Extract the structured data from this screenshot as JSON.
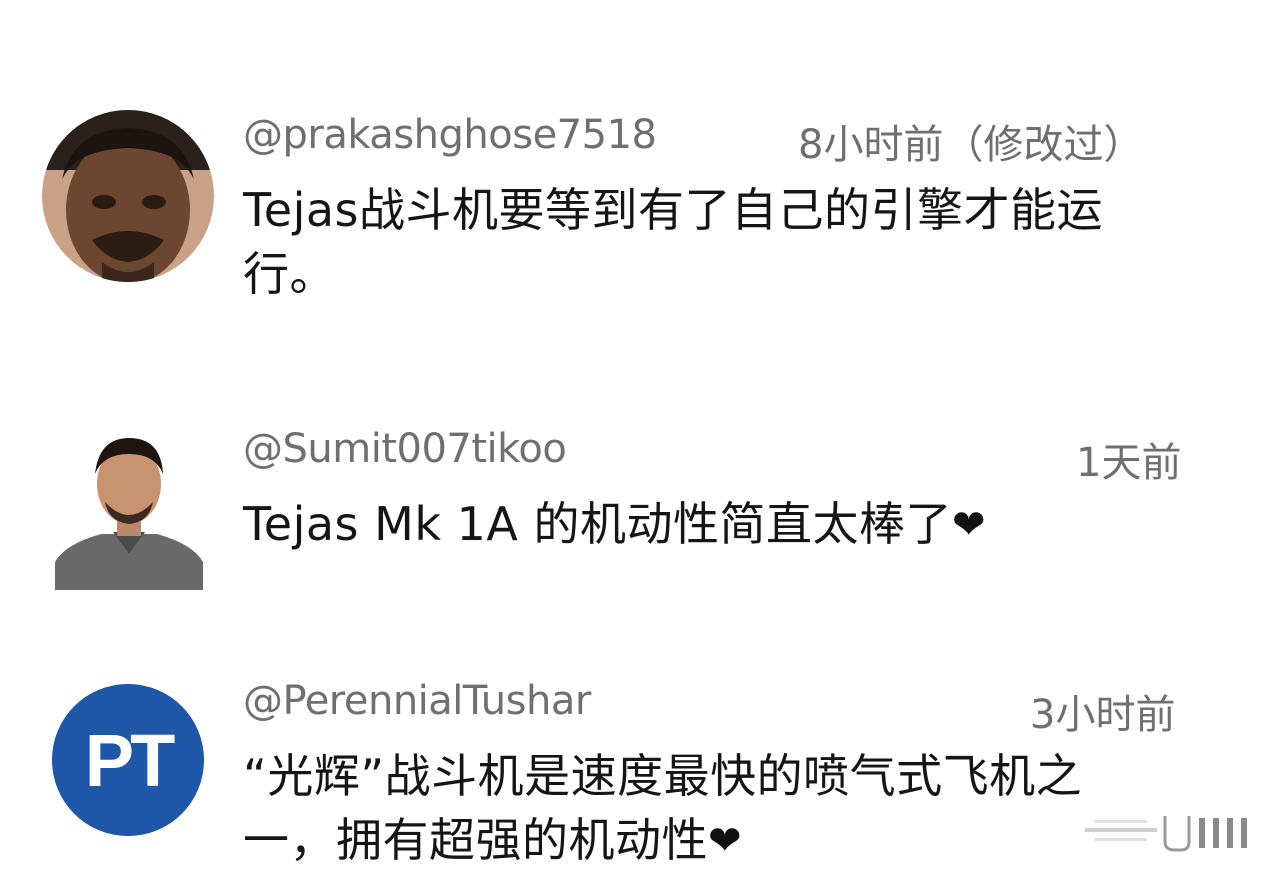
{
  "comments": [
    {
      "handle": "@prakashghose7518",
      "time": "8小时前（修改过）",
      "text_line1": "Tejas战斗机要等到有了自己的引擎才能运",
      "text_line2": "行。",
      "avatar": "profile-photo"
    },
    {
      "handle": "@Sumit007tikoo",
      "time": "1天前",
      "text_line1": "Tejas Mk 1A 的机动性简直太棒了",
      "heart": "❤",
      "avatar": "profile-photo"
    },
    {
      "handle": "@PerennialTushar",
      "time": "3小时前",
      "text_line1": "“光辉”战斗机是速度最快的喷气式飞机之",
      "text_line2": "一，拥有超强的机动性",
      "heart": "❤",
      "avatar_initials": "PT",
      "avatar_color": "#1e56a8"
    }
  ],
  "icons": {
    "heart": "heart-icon",
    "watermark": "watermark-icon"
  }
}
